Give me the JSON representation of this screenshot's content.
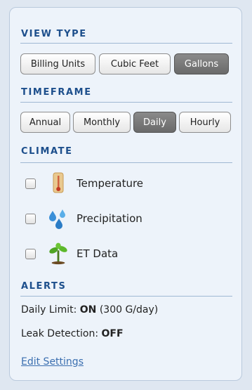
{
  "view_type": {
    "title": "VIEW TYPE",
    "options": [
      "Billing Units",
      "Cubic Feet",
      "Gallons"
    ],
    "selected": "Gallons"
  },
  "timeframe": {
    "title": "TIMEFRAME",
    "options": [
      "Annual",
      "Monthly",
      "Daily",
      "Hourly"
    ],
    "selected": "Daily"
  },
  "climate": {
    "title": "CLIMATE",
    "items": [
      {
        "label": "Temperature",
        "icon": "thermometer-icon",
        "checked": false
      },
      {
        "label": "Precipitation",
        "icon": "raindrops-icon",
        "checked": false
      },
      {
        "label": "ET Data",
        "icon": "plant-icon",
        "checked": false
      }
    ]
  },
  "alerts": {
    "title": "ALERTS",
    "daily_limit_label": "Daily Limit:",
    "daily_limit_status": "ON",
    "daily_limit_value": "(300 G/day)",
    "leak_label": "Leak Detection:",
    "leak_status": "OFF",
    "edit_link": "Edit Settings"
  },
  "colors": {
    "section_title": "#1d4f8c",
    "link": "#3b6fb0",
    "active_button": "#7a7a7a"
  }
}
